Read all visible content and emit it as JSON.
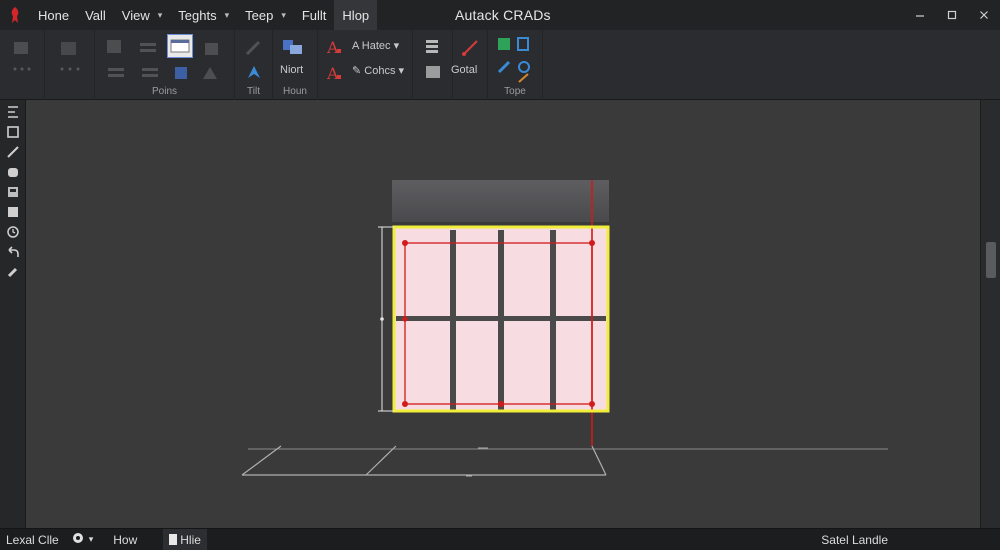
{
  "titlebar": {
    "app_title": "Autack CRADs",
    "logo_icon": "autocad-logo-icon",
    "menu": [
      {
        "label": "Hone",
        "caret": ""
      },
      {
        "label": "Vall",
        "caret": ""
      },
      {
        "label": "View",
        "caret": "▾"
      },
      {
        "label": "Teghts",
        "caret": "▾"
      },
      {
        "label": "Teep",
        "caret": "▾"
      },
      {
        "label": "Fullt",
        "caret": ""
      },
      {
        "label": "Hlop",
        "caret": ""
      }
    ],
    "active_menu": "Hlop"
  },
  "ribbon": {
    "groups": [
      {
        "label": "Poins"
      },
      {
        "label": "Tilt"
      },
      {
        "label": "Houn"
      },
      {
        "label": "Tope"
      }
    ],
    "buttons": {
      "niort": "Niort",
      "hatch": "A Hatec",
      "hatch_caret": "▾",
      "colors": "Cohcs",
      "colors_caret": "▾",
      "gotal": "Gotal"
    }
  },
  "statusbar": {
    "items": [
      "Lexal Clle",
      "How",
      "Hlie"
    ],
    "caret": "▾",
    "right_text": "Satel Landle"
  },
  "colors": {
    "selection": "#f1ee3a",
    "guide": "#d11a1a",
    "panel_fill": "#f7dce2",
    "frame": "#4a4a4a"
  }
}
